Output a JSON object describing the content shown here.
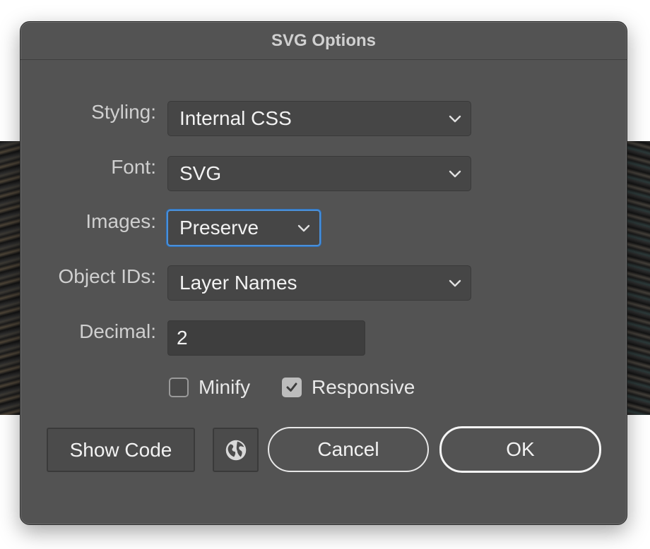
{
  "window": {
    "title": "SVG Options"
  },
  "fields": [
    {
      "label": "Styling:",
      "value": "Internal CSS",
      "icon": "chevron-down-icon"
    },
    {
      "label": "Font:",
      "value": "SVG",
      "icon": "chevron-down-icon"
    },
    {
      "label": "Images:",
      "value": "Preserve",
      "icon": "chevron-down-icon",
      "focused": true
    },
    {
      "label": "Object IDs:",
      "value": "Layer Names",
      "icon": "chevron-down-icon"
    },
    {
      "label": "Decimal:",
      "value": "2"
    }
  ],
  "options": {
    "minify": {
      "label": "Minify",
      "checked": false
    },
    "responsive": {
      "label": "Responsive",
      "checked": true
    }
  },
  "buttons": {
    "show_code": "Show Code",
    "web_icon": "globe-icon",
    "cancel": "Cancel",
    "ok": "OK"
  },
  "colors": {
    "dialog_bg": "#535353",
    "focus_ring": "#4a90d9"
  }
}
